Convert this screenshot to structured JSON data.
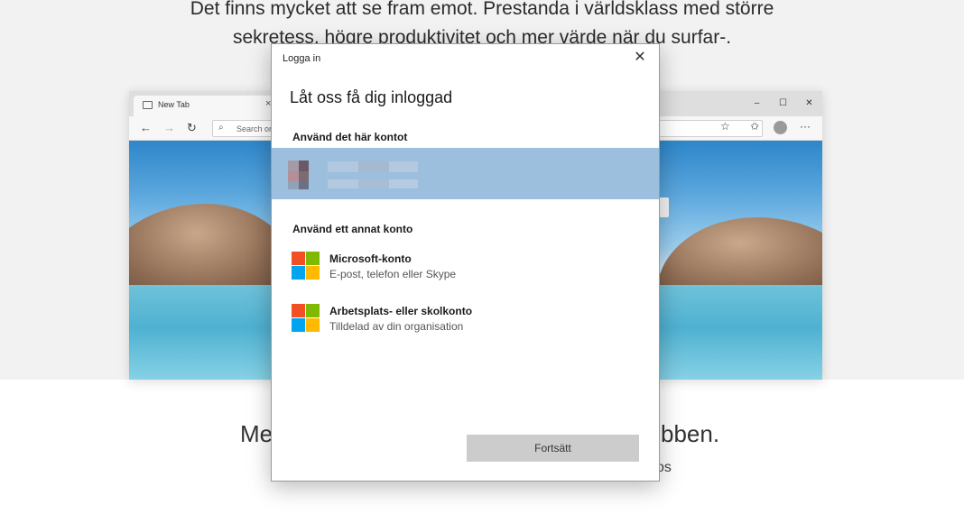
{
  "background": {
    "tagline_line1": "Det finns mycket att se fram emot. Prestanda i världsklass med större",
    "tagline_line2": "sekretess, högre produktivitet och mer värde när du surfar-.",
    "bottom_left": "Me",
    "bottom_right": "bben.",
    "bottom_small": "os",
    "browser": {
      "tab_title": "New Tab",
      "tab_close": "×",
      "address_placeholder": "Search or",
      "controls": [
        "–",
        "☐",
        "✕"
      ]
    }
  },
  "dialog": {
    "title": "Logga in",
    "close_glyph": "✕",
    "heading": "Låt oss få dig inloggad",
    "this_account_label": "Använd det här kontot",
    "other_account_label": "Använd ett annat konto",
    "options": [
      {
        "title": "Microsoft-konto",
        "subtitle": "E-post, telefon eller Skype"
      },
      {
        "title": "Arbetsplats- eller skolkonto",
        "subtitle": "Tilldelad av din organisation"
      }
    ],
    "continue_label": "Fortsätt"
  },
  "colors": {
    "selected_account_bg": "#9bbfdc",
    "button_bg": "#cccccc",
    "ms_red": "#f25022",
    "ms_green": "#7fba00",
    "ms_blue": "#00a4ef",
    "ms_yellow": "#ffb900"
  }
}
